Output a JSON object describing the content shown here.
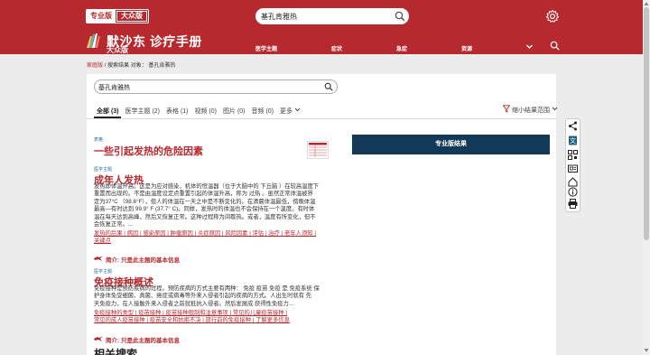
{
  "header": {
    "toggle_professional": "专业版",
    "toggle_consumer": "大众版",
    "search_value": "基孔肯雅热",
    "brand_name": "默沙东 诊疗手册",
    "brand_sub": "大众版",
    "nav": [
      "医学主题",
      "症状",
      "急症",
      "资源"
    ]
  },
  "breadcrumb": {
    "home": "家庭版",
    "separator": "/",
    "current": "搜索结果 对象：  基孔肯雅热"
  },
  "search": {
    "value": "基孔肯雅热"
  },
  "tabs": [
    "全部 (3)",
    "医学主题 (2)",
    "表格 (1)",
    "视频 (0)",
    "图片 (0)",
    "音频 (0)",
    "更多"
  ],
  "filter_label": "缩小结果范围",
  "results": [
    {
      "type": "表格",
      "title": "一些引起发热的危险因素"
    },
    {
      "type": "医学主题",
      "title": "成年人发热",
      "body": [
        "发热即体温升高。这是为应对感染，机体的恒温器（位于大脑中的 下丘脑 ）在较高温度下",
        "重置而出现的。不是由温度设定点重置引起的体温升高，称为 过热 。虽然正常体温被界",
        "定为37°C （98.6°F），但人的体温在一天之中是不断变化的。在清晨体温最低，傍晚体温",
        "最高—有时达到 99.9° F (37.7° C)。同样，发热时的体温也不会保持在一个温度。有时体",
        "温在每天达到高峰，然后又恢复正常。这种过程称为间歇热。或者，温度有所变化，但不",
        "会恢复正常。..."
      ],
      "links": [
        "发热的后果 | 病因 | 感染原因 | 肿瘤原因 | 炎症原因 | 风险因素 | 评估 | 治疗 | 老年人须知 |",
        "关键点"
      ],
      "summary": "简介: 只是此主题的基本信息"
    },
    {
      "type": "医学主题",
      "title": "免疫接种概述",
      "body": [
        "免疫接种是预防疾病的过程。预防疾病的方式主要有两种： 免疫 疫苗 免疫 是 免疫系统 保",
        "护身体免受细菌、真菌、癌症或病毒等外来入侵者引起的疾病的方式。人出生时就有 先",
        "天免疫力，在人接触外来入侵者之前就抵抗入侵者。然后发展成 获得性免疫力..."
      ],
      "links": [
        "免疫接种的类型 | 疫苗接种 | 疫苗接种限制和注意事项 | 常见的儿童疫苗接种 |",
        "常见的成人疫苗接种 | 疫苗安全和抗拒不决 | 旅行前的免疫接种 | 了解更多信息"
      ],
      "summary": "简介: 只是此主题的基本信息"
    }
  ],
  "related_heading": "相关搜索",
  "professional_button": "专业版结果",
  "sidebar_icons": [
    "share-icon",
    "translate-icon",
    "qr-code-icon",
    "home-icon",
    "info-icon",
    "print-icon"
  ],
  "colors": {
    "brand_red": "#b5292f",
    "navy": "#123a58",
    "link_blue": "#2a6c9a"
  }
}
